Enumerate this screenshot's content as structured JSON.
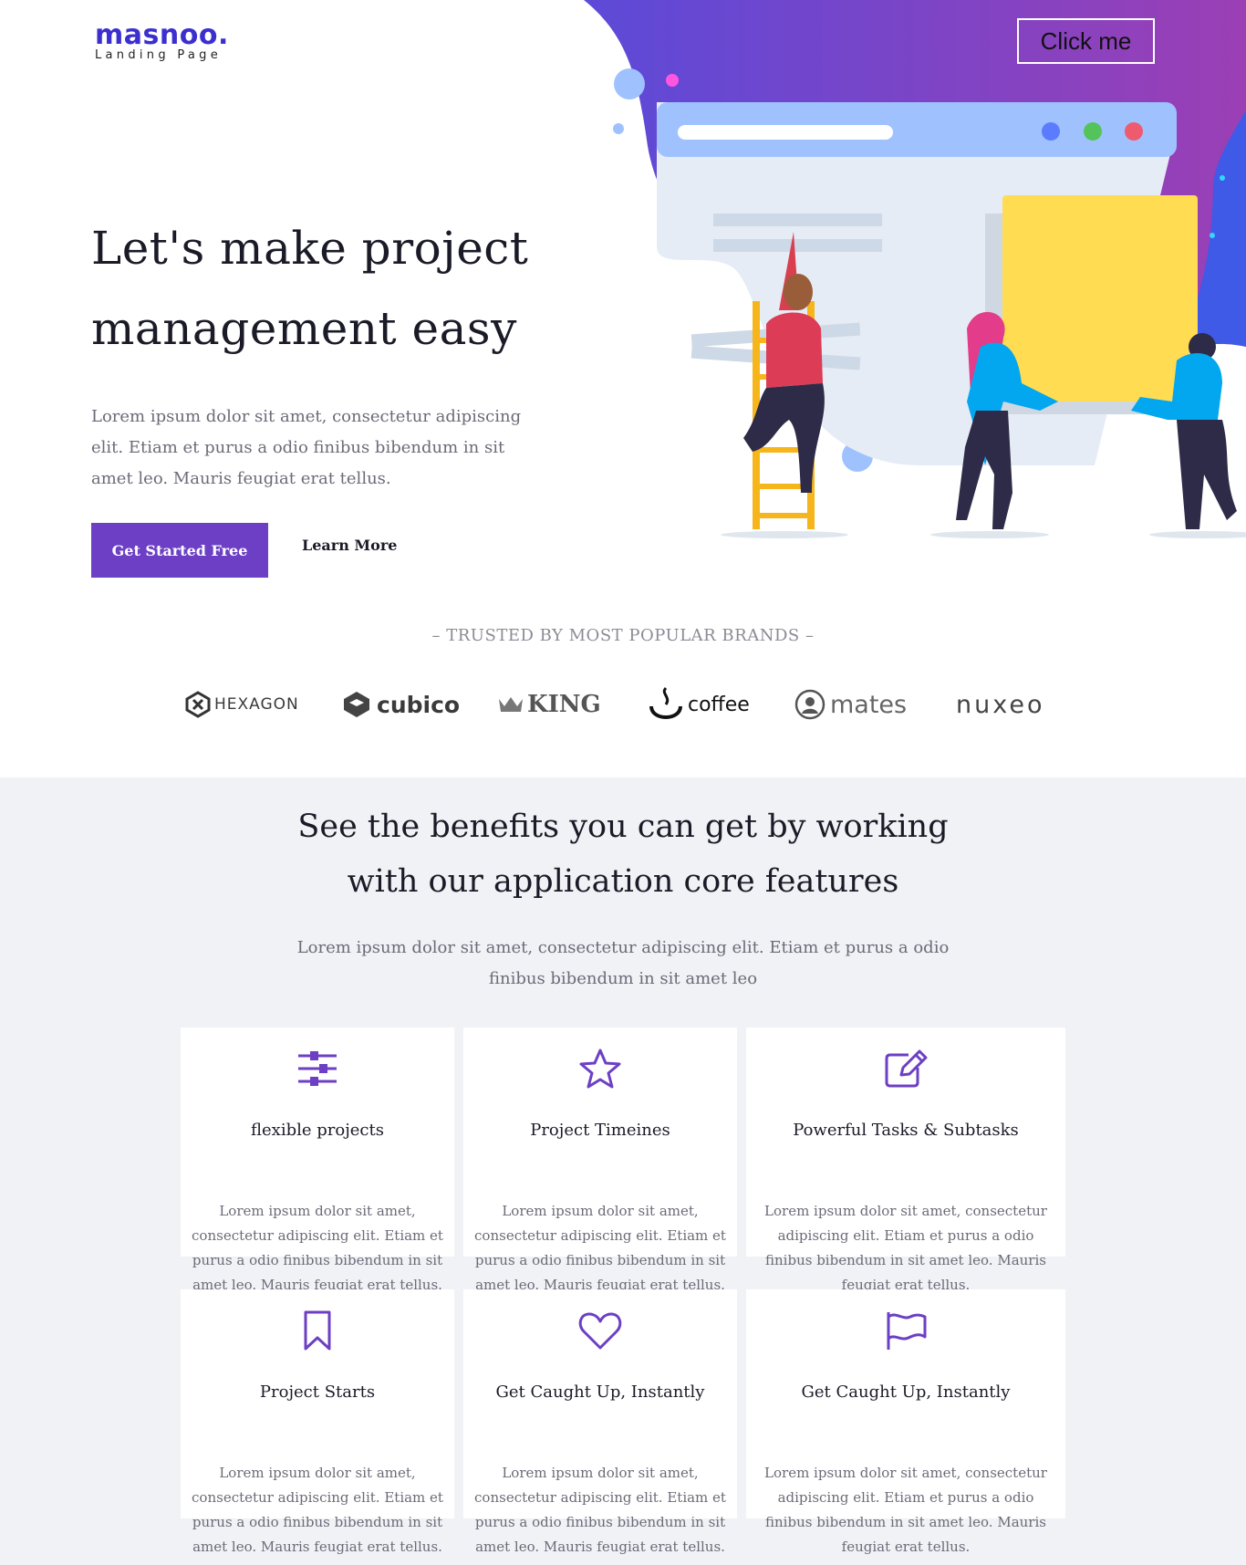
{
  "header": {
    "logo_word": "masnoo.",
    "logo_sub": "Landing Page",
    "cta_label": "Click me"
  },
  "hero": {
    "title_line1": "Let's make project",
    "title_line2": "management easy",
    "description": "Lorem ipsum dolor sit amet, consectetur adipiscing elit. Etiam et purus a odio finibus bibendum in sit amet leo. Mauris feugiat erat tellus.",
    "primary_button": "Get Started Free",
    "secondary_link": "Learn More"
  },
  "brands": {
    "title": "– TRUSTED BY MOST POPULAR BRANDS –",
    "items": [
      "HEXAGON",
      "cubico",
      "KING",
      "coffee",
      "mates",
      "nuxeo"
    ]
  },
  "features": {
    "title_line1": "See the benefits you can get by working",
    "title_line2": "with our application core features",
    "description": "Lorem ipsum dolor sit amet, consectetur adipiscing elit. Etiam et purus a odio finibus bibendum in sit amet leo",
    "cards": [
      {
        "icon": "sliders-icon",
        "title": "flexible projects",
        "text": "Lorem ipsum dolor sit amet, consectetur adipiscing elit. Etiam et purus a odio finibus bibendum in sit amet leo. Mauris feugiat erat tellus."
      },
      {
        "icon": "star-icon",
        "title": "Project Timeines",
        "text": "Lorem ipsum dolor sit amet, consectetur adipiscing elit. Etiam et purus a odio finibus bibendum in sit amet leo. Mauris feugiat erat tellus."
      },
      {
        "icon": "edit-icon",
        "title": "Powerful Tasks & Subtasks",
        "text": "Lorem ipsum dolor sit amet, consectetur adipiscing elit. Etiam et purus a odio finibus bibendum in sit amet leo. Mauris feugiat erat tellus."
      },
      {
        "icon": "bookmark-icon",
        "title": "Project Starts",
        "text": "Lorem ipsum dolor sit amet, consectetur adipiscing elit. Etiam et purus a odio finibus bibendum in sit amet leo. Mauris feugiat erat tellus."
      },
      {
        "icon": "heart-icon",
        "title": "Get Caught Up, Instantly",
        "text": "Lorem ipsum dolor sit amet, consectetur adipiscing elit. Etiam et purus a odio finibus bibendum in sit amet leo. Mauris feugiat erat tellus."
      },
      {
        "icon": "flag-icon",
        "title": "Get Caught Up, Instantly",
        "text": "Lorem ipsum dolor sit amet, consectetur adipiscing elit. Etiam et purus a odio finibus bibendum in sit amet leo. Mauris feugiat erat tellus."
      }
    ]
  },
  "colors": {
    "accent": "#6c3fc4",
    "logo": "#3b2fd0",
    "gradient_start": "#3b5bf0",
    "gradient_end": "#9b3fb5",
    "section_bg": "#f1f2f6"
  }
}
